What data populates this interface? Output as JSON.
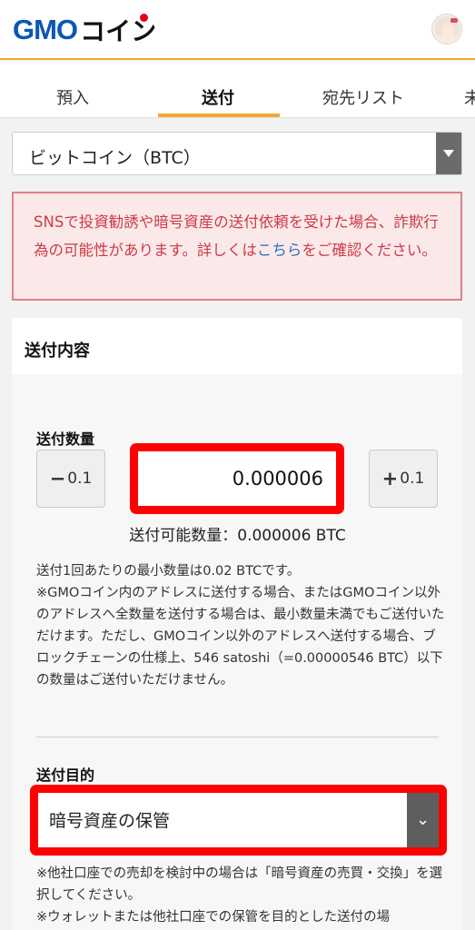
{
  "header": {
    "logo_text": "GMO",
    "logo_sub": "コイン",
    "avatar_icon": "user-avatar-icon"
  },
  "tabs": [
    {
      "label": "預入",
      "active": false
    },
    {
      "label": "送付",
      "active": true
    },
    {
      "label": "宛先リスト",
      "active": false
    },
    {
      "label": "未",
      "active": false
    }
  ],
  "coin_select": {
    "value": "ビットコイン（BTC）",
    "icon": "caret-down-icon"
  },
  "warning": {
    "text_before_link": "SNSで投資勧誘や暗号資産の送付依頼を受けた場合、詐欺行為の可能性があります。詳しくは",
    "link_text": "こちら",
    "text_after_link": "をご確認ください。"
  },
  "send_section": {
    "title": "送付内容",
    "quantity_label": "送付数量",
    "minus_label": "0.1",
    "plus_label": "0.1",
    "quantity_value": "0.000006",
    "available": "送付可能数量：0.000006 BTC",
    "note": "送付1回あたりの最小数量は0.02 BTCです。\n※GMOコイン内のアドレスに送付する場合、またはGMOコイン以外のアドレスへ全数量を送付する場合は、最小数量未満でもご送付いただけます。ただし、GMOコイン以外のアドレスへ送付する場合、ブロックチェーンの仕様上、546 satoshi（=0.00000546 BTC）以下の数量はご送付いただけません。",
    "purpose_label": "送付目的",
    "purpose_value": "暗号資産の保管",
    "purpose_icon": "chevron-down-icon",
    "purpose_note": "※他社口座での売却を検討中の場合は「暗号資産の売買・交換」を選択してください。\n※ウォレットまたは他社口座での保管を目的とした送付の場"
  },
  "colors": {
    "brand_blue": "#0a56b4",
    "accent_orange": "#f2a92e",
    "warning_red": "#cc3b46",
    "highlight_red": "#ff0000",
    "link_blue": "#2f6fc0"
  }
}
